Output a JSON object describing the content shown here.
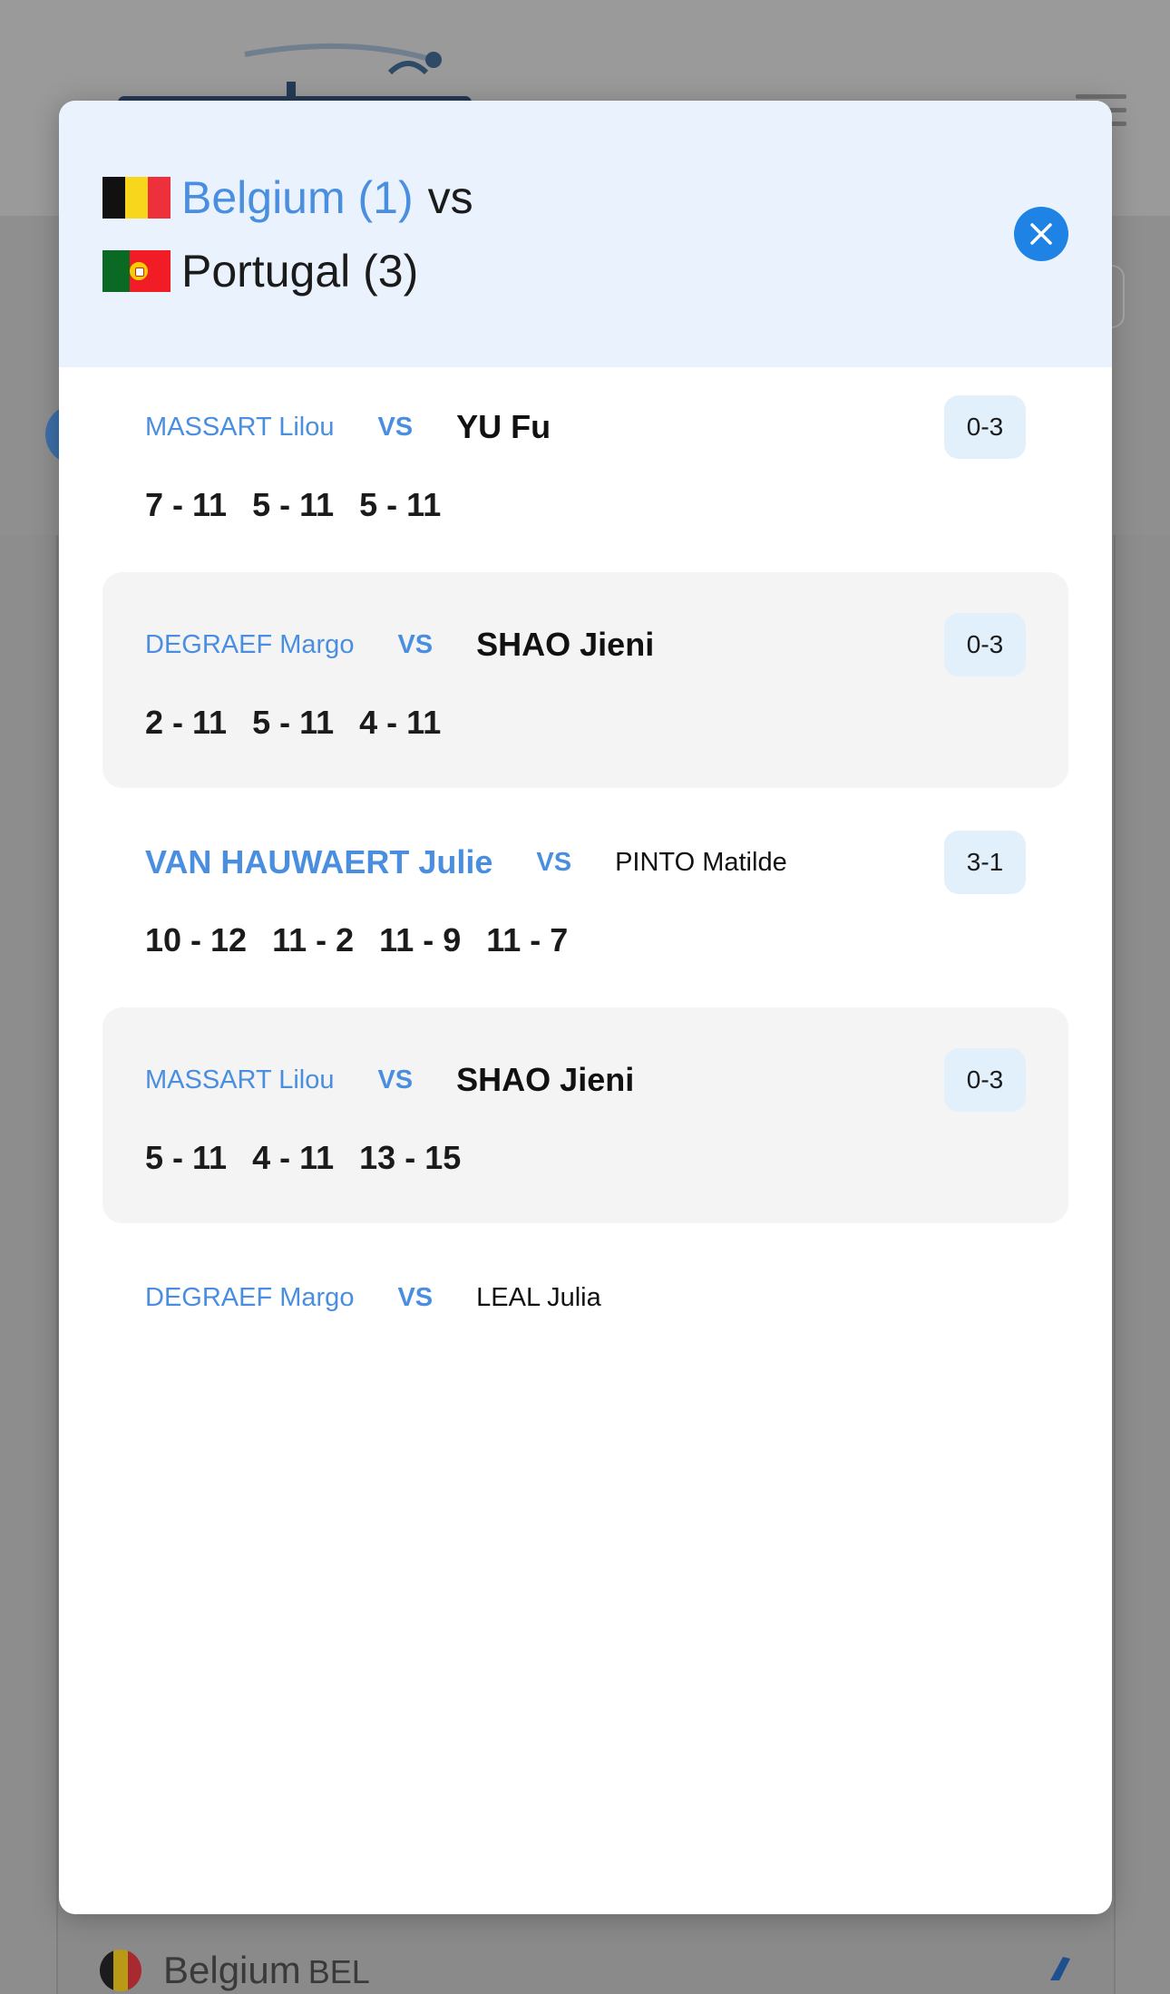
{
  "colors": {
    "accent_blue": "#4a8ee0",
    "close_button": "#1f83e6",
    "modal_header_bg": "#eaf3fd",
    "badge_bg": "#e2f0fc",
    "row_shade": "#f4f4f4"
  },
  "modal": {
    "home_team": {
      "name": "Belgium (1)",
      "flag": "belgium-flag"
    },
    "vs_text": "vs",
    "away_team": {
      "name": "Portugal (3)",
      "flag": "portugal-flag"
    },
    "close_icon": "close-icon"
  },
  "matches": [
    {
      "home": "MASSART Lilou",
      "vs": "VS",
      "away": "YU Fu",
      "winner": "away",
      "result": "0-3",
      "sets": [
        "7 - 11",
        "5 - 11",
        "5 - 11"
      ]
    },
    {
      "home": "DEGRAEF Margo",
      "vs": "VS",
      "away": "SHAO Jieni",
      "winner": "away",
      "result": "0-3",
      "sets": [
        "2 - 11",
        "5 - 11",
        "4 - 11"
      ]
    },
    {
      "home": "VAN HAUWAERT Julie",
      "vs": "VS",
      "away": "PINTO Matilde",
      "winner": "home",
      "result": "3-1",
      "sets": [
        "10 - 12",
        "11 - 2",
        "11 - 9",
        "11 - 7"
      ]
    },
    {
      "home": "MASSART Lilou",
      "vs": "VS",
      "away": "SHAO Jieni",
      "winner": "away",
      "result": "0-3",
      "sets": [
        "5 - 11",
        "4 - 11",
        "13 - 15"
      ]
    },
    {
      "home": "DEGRAEF Margo",
      "vs": "VS",
      "away": "LEAL Julia",
      "winner": "",
      "result": "",
      "sets": []
    }
  ],
  "background": {
    "team_name": "Belgium",
    "team_code": "BEL"
  }
}
